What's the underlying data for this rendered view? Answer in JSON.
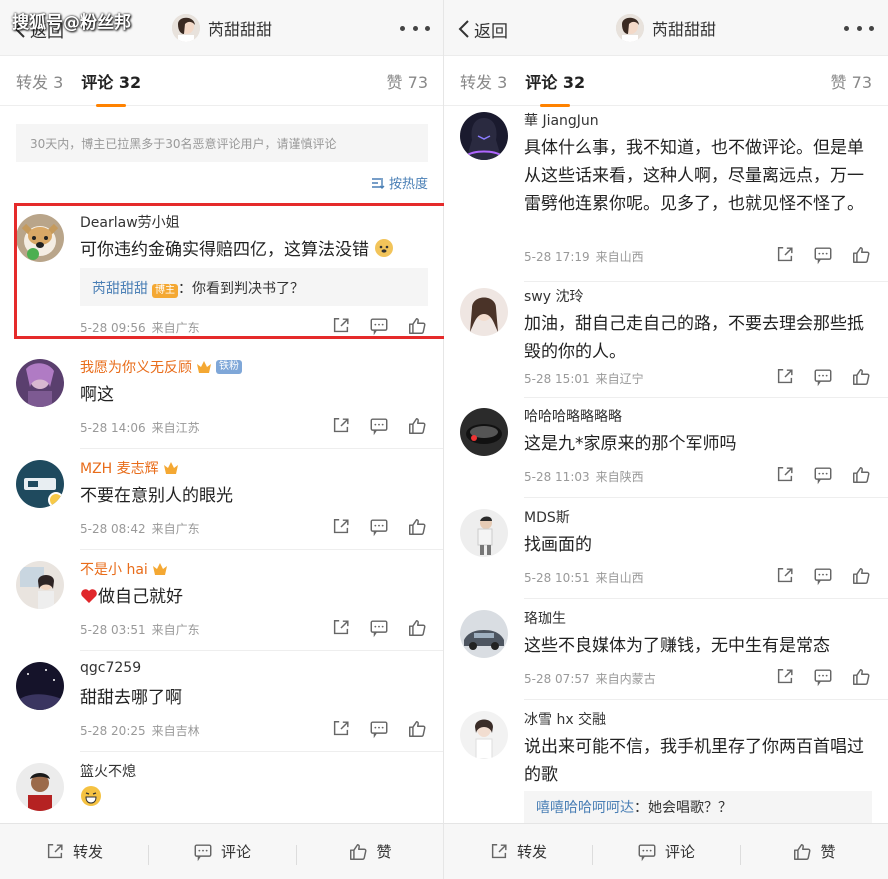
{
  "watermark": "搜狐号@粉丝邦",
  "left": {
    "header": {
      "back_label": "返回",
      "name": "芮甜甜甜"
    },
    "tabs": {
      "repost": "转发 3",
      "comments": "评论 32",
      "likes": "赞 73"
    },
    "notice": "30天内，博主已拉黑多于30名恶意评论用户，请谨慎评论",
    "sort_label": "按热度",
    "comments": [
      {
        "name": "Dearlaw劳小姐",
        "text": "可你违约金确实得赔四亿，这算法没错",
        "reply_name": "芮甜甜甜",
        "reply_badge": "博主",
        "reply_text": "：你看到判决书了？",
        "date": "5-28 09:56",
        "location": "来自广东"
      },
      {
        "name": "我愿为你义无反顾",
        "badge": "铁粉",
        "text": "啊这",
        "date": "5-28 14:06",
        "location": "来自江苏"
      },
      {
        "name": "MZH 麦志辉",
        "text": "不要在意别人的眼光",
        "date": "5-28 08:42",
        "location": "来自广东"
      },
      {
        "name": "不是小 hai",
        "text": "做自己就好",
        "date": "5-28 03:51",
        "location": "来自广东"
      },
      {
        "name": "qgc7259",
        "text": "甜甜去哪了啊",
        "date": "5-28 20:25",
        "location": "来自吉林"
      },
      {
        "name": "篮火不熄"
      }
    ],
    "bottom": {
      "repost": "转发",
      "comment": "评论",
      "like": "赞"
    }
  },
  "right": {
    "header": {
      "back_label": "返回",
      "name": "芮甜甜甜"
    },
    "tabs": {
      "repost": "转发 3",
      "comments": "评论 32",
      "likes": "赞 73"
    },
    "comments": [
      {
        "name": "華 JiangJun",
        "text": "具体什么事，我不知道，也不做评论。但是单从这些话来看，这种人啊，尽量离远点，万一雷劈他连累你呢。见多了，也就见怪不怪了。",
        "date": "5-28 17:19",
        "location": "来自山西"
      },
      {
        "name": "swy 沈玲",
        "text": "加油，甜自己走自己的路，不要去理会那些抵毁的你的人。",
        "date": "5-28 15:01",
        "location": "来自辽宁"
      },
      {
        "name": "哈哈哈略略略略",
        "text": "这是九*家原来的那个军师吗",
        "date": "5-28 11:03",
        "location": "来自陕西"
      },
      {
        "name": "MDS斯",
        "text": "找画面的",
        "date": "5-28 10:51",
        "location": "来自山西"
      },
      {
        "name": "珞珈生",
        "text": "这些不良媒体为了赚钱，无中生有是常态",
        "date": "5-28 07:57",
        "location": "来自内蒙古"
      },
      {
        "name": "冰雪 hx 交融",
        "text": "说出来可能不信，我手机里存了你两百首唱过的歌",
        "reply_name": "嘻嘻哈哈呵呵达",
        "reply_text": "：她会唱歌？？"
      }
    ],
    "bottom": {
      "repost": "转发",
      "comment": "评论",
      "like": "赞"
    }
  },
  "colors": {
    "accent": "#ff8200",
    "link": "#4a7fb5",
    "highlight_border": "#e52a2a",
    "orange_name": "#e86c1a"
  }
}
